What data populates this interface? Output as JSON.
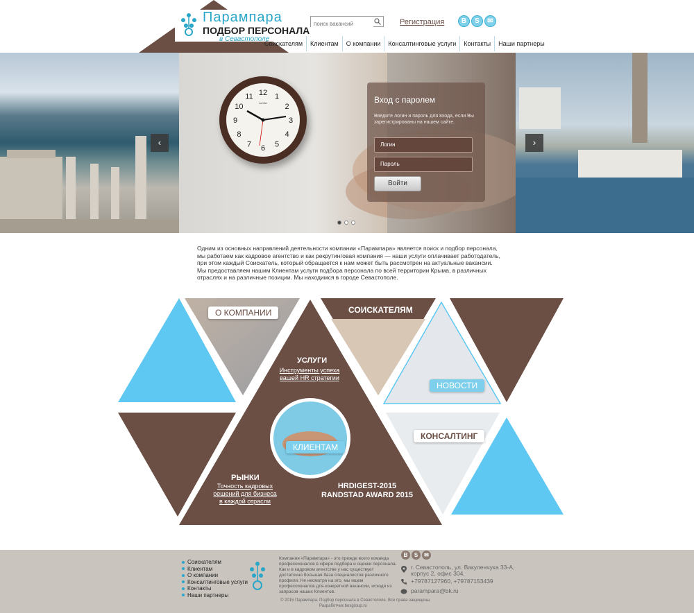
{
  "header": {
    "logo_line1": "Парампара",
    "logo_line2": "ПОДБОР ПЕРСОНАЛА",
    "logo_line3": "в Севастополе",
    "search_placeholder": "поиск вакансий",
    "register_link": "Регистрация",
    "social": [
      "В",
      "S",
      "✉"
    ]
  },
  "nav": {
    "items": [
      "Соискателям",
      "Клиентам",
      "О компании",
      "Консалтинговые услуги",
      "Контакты",
      "Наши партнеры"
    ]
  },
  "hero": {
    "prev_arrow": "‹",
    "next_arrow": "›",
    "clock_brand": "La Mer",
    "clock_numbers": [
      "12",
      "1",
      "2",
      "3",
      "4",
      "5",
      "6",
      "7",
      "8",
      "9",
      "10",
      "11"
    ],
    "login": {
      "title": "Вход с паролем",
      "description": "Введите логин и пароль для входа, если Вы зарегистрированы на нашем сайте.",
      "login_placeholder": "Логин",
      "password_placeholder": "Пароль",
      "submit": "Войти"
    }
  },
  "intro": "Одним из основных направлений деятельности компании «Парампара» является поиск и подбор персонала, мы работаем как кадровое агентство и как рекрутинговая компания — наши услуги оплачивает работодатель, при этом каждый Соискатель, который обращается к нам может быть рассмотрен на актуальные вакансии. Мы предоставляем нашим Клиентам услуги подбора персонала по всей территории Крыма, в различных отраслях и на различные позиции. Мы находимся в городе Севастополе.",
  "sections": {
    "about": "О КОМПАНИИ",
    "seekers": "СОИСКАТЕЛЯМ",
    "services_title": "УСЛУГИ",
    "services_sub": "Инструменты успеха вашей HR стратегии",
    "news": "НОВОСТИ",
    "clients": "КЛИЕНТАМ",
    "consulting": "КОНСАЛТИНГ",
    "markets_title": "РЫНКИ",
    "markets_sub": "Точность кадровых решений для бизнеса в каждой отрасли",
    "award_line1": "HRDIGEST-2015",
    "award_line2": "RANDSTAD AWARD 2015"
  },
  "footer": {
    "menu": [
      "Соискателям",
      "Клиентам",
      "О компании",
      "Консалтинговые услуги",
      "Контакты",
      "Наши партнеры"
    ],
    "description": "Компания «Парампара» - это прежде всего команда профессионалов в сфере подбора и оценки персонала. Как и в кадровом агентстве у нас существует достаточно большая база специалистов различного профиля. Не несмотря на это, мы ищем профессионалов для конкретной вакансии, исходя из запросов наших Клиентов.",
    "copyright": "© 2015 Парампара. Подбор персонала в Севастополе. Все права защищены",
    "developer": "Разработчик bexgroup.ru",
    "social": [
      "В",
      "S",
      "✉"
    ],
    "address": "г. Севастополь, ул. Вакуленчука 33-А, корпус 2, офис 304,",
    "phones": "+79787127960, +79787153439",
    "email": "parampara@bk.ru"
  },
  "colors": {
    "brown": "#6b4f45",
    "blue": "#5ec8f2",
    "footer_bg": "#c9c4be"
  }
}
